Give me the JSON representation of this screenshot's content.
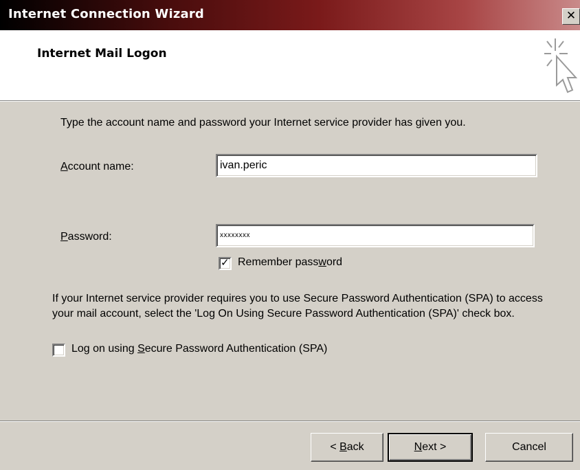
{
  "window": {
    "title": "Internet Connection Wizard",
    "close_glyph": "✕"
  },
  "header": {
    "title": "Internet Mail Logon",
    "icon": "wizard-cursor-icon"
  },
  "body": {
    "intro": "Type the account name and password your Internet service provider has given you.",
    "account_label_accel": "A",
    "account_label_rest": "ccount name:",
    "account_value": "ivan.peric",
    "password_label_accel": "P",
    "password_label_rest": "assword:",
    "password_value": "xxxxxxxx",
    "remember_pre": "Remember pass",
    "remember_accel": "w",
    "remember_post": "ord",
    "remember_checked": true,
    "spa_info": "If your Internet service provider requires you to use Secure Password Authentication (SPA) to access your mail account, select the 'Log On Using Secure Password Authentication (SPA)' check box.",
    "spa_pre": "Log on using ",
    "spa_accel": "S",
    "spa_post": "ecure Password Authentication (SPA)",
    "spa_checked": false
  },
  "buttons": {
    "back_pre": "< ",
    "back_accel": "B",
    "back_post": "ack",
    "next_accel": "N",
    "next_post": "ext >",
    "cancel": "Cancel"
  }
}
